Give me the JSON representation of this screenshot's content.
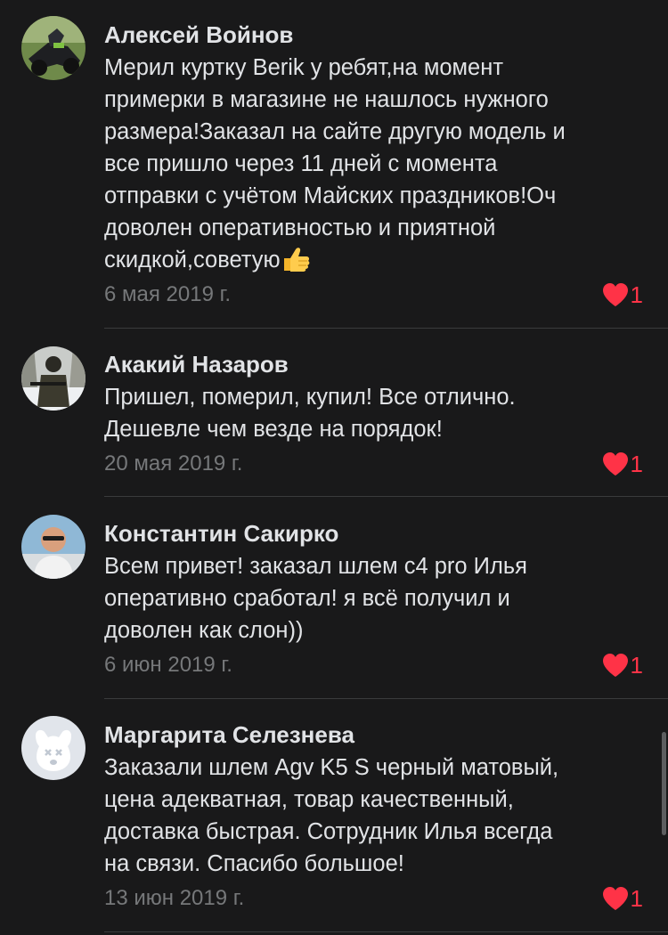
{
  "reviews": [
    {
      "author": "Алексей Войнов",
      "lines": [
        "Мерил куртку Berik у ребят,на момент",
        "примерки в магазине не нашлось нужного",
        "размера!Заказал на сайте другую модель и",
        "все пришло через 11 дней с момента",
        "отправки с учётом Майских праздников!Оч",
        "доволен оперативностью и приятной",
        "скидкой,советую"
      ],
      "emoji": "thumbs-up-icon",
      "date": "6 мая 2019 г.",
      "likes": "1"
    },
    {
      "author": "Акакий Назаров",
      "lines": [
        "Пришел, померил, купил! Все отлично.",
        "Дешевле чем везде на порядок!"
      ],
      "date": "20 мая 2019 г.",
      "likes": "1"
    },
    {
      "author": "Константин Сакирко",
      "lines": [
        "Всем привет! заказал шлем с4 pro Илья",
        "оперативно сработал! я всё получил и",
        "доволен как слон))"
      ],
      "date": "6 июн 2019 г.",
      "likes": "1"
    },
    {
      "author": "Маргарита Селезнева",
      "lines": [
        "Заказали шлем Agv K5 S черный матовый,",
        "цена адекватная, товар качественный,",
        "доставка быстрая. Сотрудник Илья всегда",
        "на связи. Спасибо большое!"
      ],
      "date": "13 июн 2019 г.",
      "likes": "1"
    }
  ],
  "colors": {
    "background": "#19191a",
    "text": "#e1e3e6",
    "secondary": "#76787a",
    "like": "#ff3347",
    "divider": "#3a3b3c"
  }
}
